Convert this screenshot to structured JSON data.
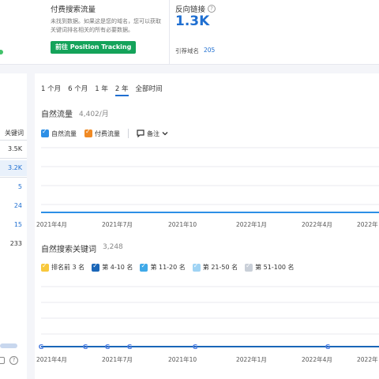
{
  "paid": {
    "title": "付费搜索流量",
    "desc": "未找到数据。如果这是您的域名，您可以获取关键词排名相关的所有必要数据。",
    "button": "前往 Position Tracking"
  },
  "backlinks": {
    "title": "反向链接",
    "value": "1.3K",
    "ref_label": "引荐域名",
    "ref_value": "205"
  },
  "left_table": {
    "header": "关键词",
    "values": [
      "3.5K",
      "3.2K",
      "5",
      "24",
      "15",
      "233"
    ]
  },
  "periods": [
    "1 个月",
    "6 个月",
    "1 年",
    "2 年",
    "全部时间"
  ],
  "active_period": "2 年",
  "traffic": {
    "title": "自然流量",
    "subtitle": "4,402/月",
    "legend": [
      "自然流量",
      "付费流量"
    ],
    "notes": "备注",
    "x_labels": [
      "2021年4月",
      "2021年7月",
      "2021年10",
      "2022年1月",
      "2022年4月",
      "2022年"
    ]
  },
  "keywords": {
    "title": "自然搜索关键词",
    "subtitle": "3,248",
    "legend": [
      "排名前 3 名",
      "第 4-10 名",
      "第 11-20 名",
      "第 21-50 名",
      "第 51-100 名"
    ],
    "x_labels": [
      "2021年4月",
      "2021年7月",
      "2021年10",
      "2022年1月",
      "2022年4月",
      "2022年"
    ]
  },
  "colors": {
    "organic": "#2d8fe6",
    "paid": "#f08a24",
    "top3": "#f8c83c",
    "p4_10": "#1a66b8",
    "p11_20": "#3fa9e8",
    "p21_50": "#9fd3f4",
    "p51_100": "#c9cfd8",
    "accent": "#1f6fd1",
    "button": "#14a35a"
  }
}
